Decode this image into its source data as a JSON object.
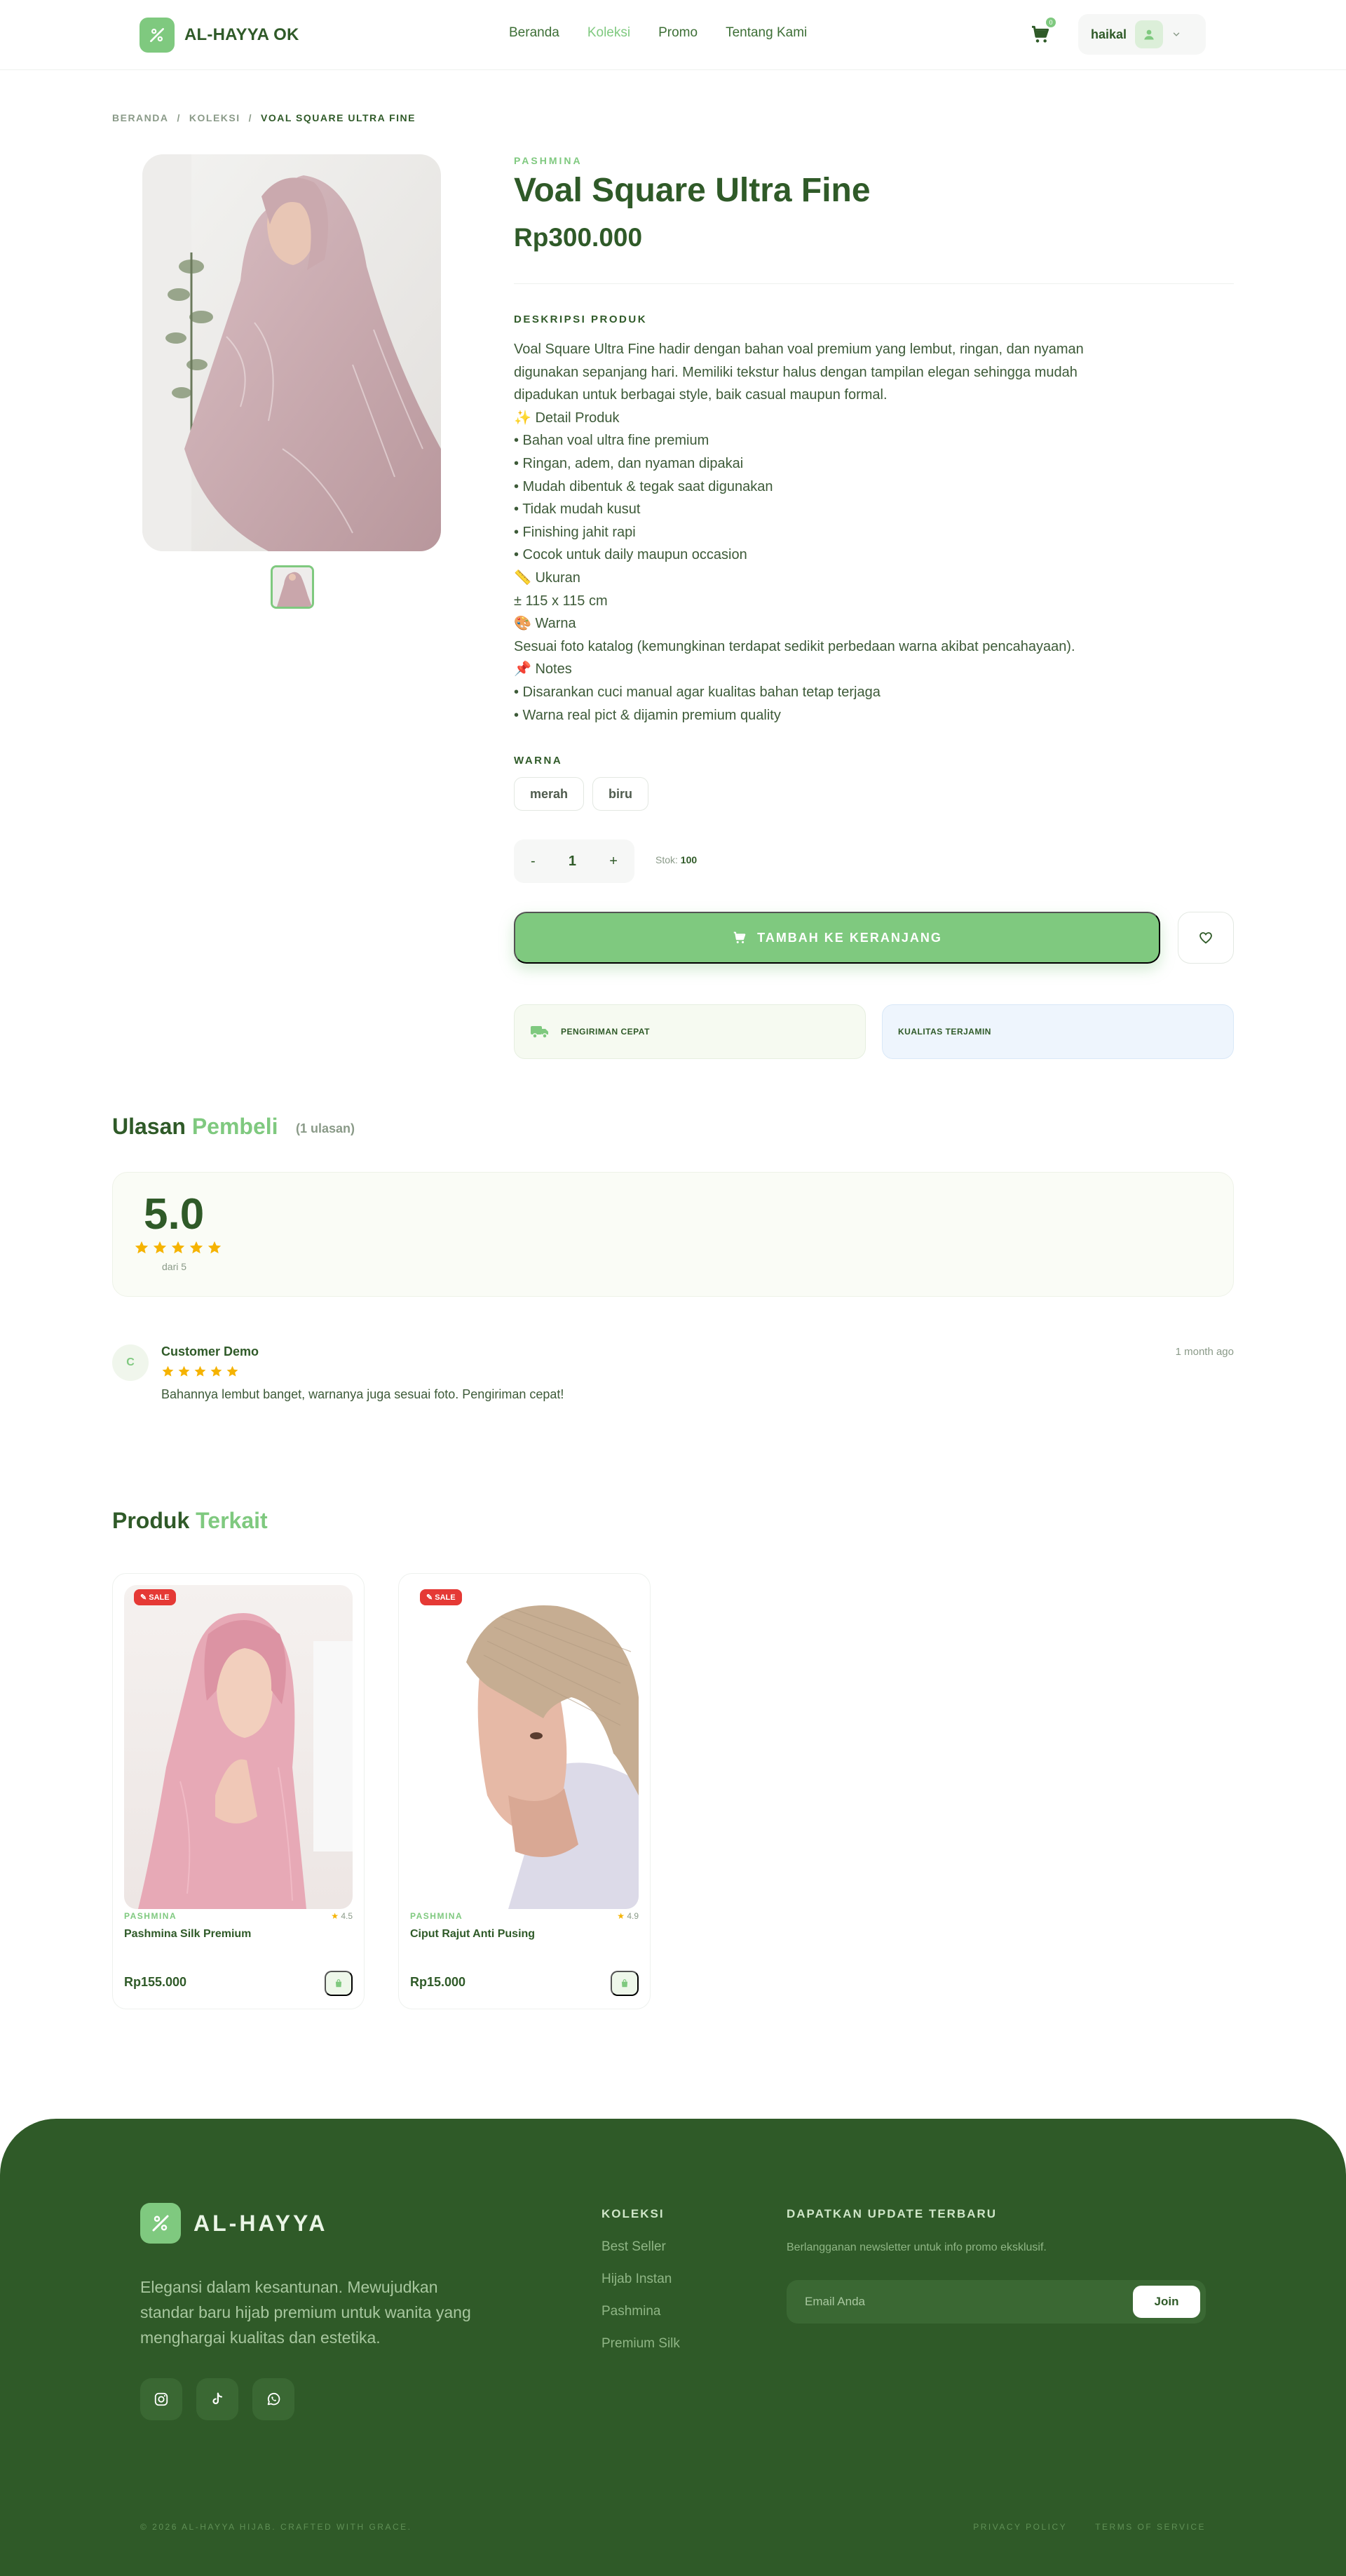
{
  "brand": {
    "name": "AL-HAYYA OK",
    "footer_name": "AL-HAYYA"
  },
  "nav": [
    {
      "label": "Beranda",
      "active": false
    },
    {
      "label": "Koleksi",
      "active": true
    },
    {
      "label": "Promo",
      "active": false
    },
    {
      "label": "Tentang Kami",
      "active": false
    }
  ],
  "cart": {
    "count": "0"
  },
  "user": {
    "name": "haikal"
  },
  "breadcrumb": {
    "home": "BERANDA",
    "sep1": "/",
    "collection": "KOLEKSI",
    "sep2": "/",
    "current": "VOAL SQUARE ULTRA FINE"
  },
  "product": {
    "category": "PASHMINA",
    "name": "Voal Square Ultra Fine",
    "price": "Rp300.000",
    "description_label": "DESKRIPSI PRODUK",
    "description": [
      "Voal Square Ultra Fine hadir dengan bahan voal premium yang lembut, ringan, dan nyaman",
      "digunakan sepanjang hari. Memiliki tekstur halus dengan tampilan elegan sehingga mudah",
      "dipadukan untuk berbagai style, baik casual maupun formal.",
      "✨ Detail Produk",
      "• Bahan voal ultra fine premium",
      "• Ringan, adem, dan nyaman dipakai",
      "• Mudah dibentuk & tegak saat digunakan",
      "• Tidak mudah kusut",
      "• Finishing jahit rapi",
      "• Cocok untuk daily maupun occasion",
      "📏 Ukuran",
      "± 115 x 115 cm",
      "🎨 Warna",
      "Sesuai foto katalog (kemungkinan terdapat sedikit perbedaan warna akibat pencahayaan).",
      "📌 Notes",
      "• Disarankan cuci manual agar kualitas bahan tetap terjaga",
      "• Warna real pict & dijamin premium quality"
    ],
    "color_label": "WARNA",
    "colors": [
      "merah",
      "biru"
    ],
    "quantity": {
      "minus": "-",
      "value": "1",
      "plus": "+"
    },
    "stock_label": "Stok:",
    "stock_value": "100",
    "add_to_cart": "TAMBAH KE KERANJANG",
    "features": [
      "PENGIRIMAN CEPAT",
      "KUALITAS TERJAMIN"
    ]
  },
  "reviews": {
    "title_a": "Ulasan",
    "title_b": "Pembeli",
    "count": "(1 ulasan)",
    "score": "5.0",
    "score_rating": 5,
    "out_of": "dari 5",
    "items": [
      {
        "initial": "C",
        "name": "Customer Demo",
        "rating": 5,
        "text": "Bahannya lembut banget, warnanya juga sesuai foto. Pengiriman cepat!",
        "time": "1 month ago"
      }
    ]
  },
  "related": {
    "title_a": "Produk",
    "title_b": "Terkait",
    "items": [
      {
        "badge": "SALE",
        "category": "PASHMINA",
        "rating": "4.5",
        "name": "Pashmina Silk Premium",
        "price": "Rp155.000"
      },
      {
        "badge": "SALE",
        "category": "PASHMINA",
        "rating": "4.9",
        "name": "Ciput Rajut Anti Pusing",
        "price": "Rp15.000"
      }
    ]
  },
  "footer": {
    "tagline": "Elegansi dalam kesantunan. Mewujudkan standar baru hijab premium untuk wanita yang menghargai kualitas dan estetika.",
    "collections_heading": "KOLEKSI",
    "collections": [
      "Best Seller",
      "Hijab Instan",
      "Pashmina",
      "Premium Silk"
    ],
    "newsletter_heading": "DAPATKAN UPDATE TERBARU",
    "newsletter_note": "Berlangganan newsletter untuk info promo eksklusif.",
    "email_placeholder": "Email Anda",
    "join": "Join",
    "copyright": "© 2026 AL-HAYYA HIJAB. CRAFTED WITH GRACE.",
    "privacy": "PRIVACY POLICY",
    "terms": "TERMS OF SERVICE"
  },
  "colors": {
    "primary": "#7fc97f",
    "dark": "#2f5a28",
    "sale": "#e53935",
    "star": "#f5b301"
  }
}
